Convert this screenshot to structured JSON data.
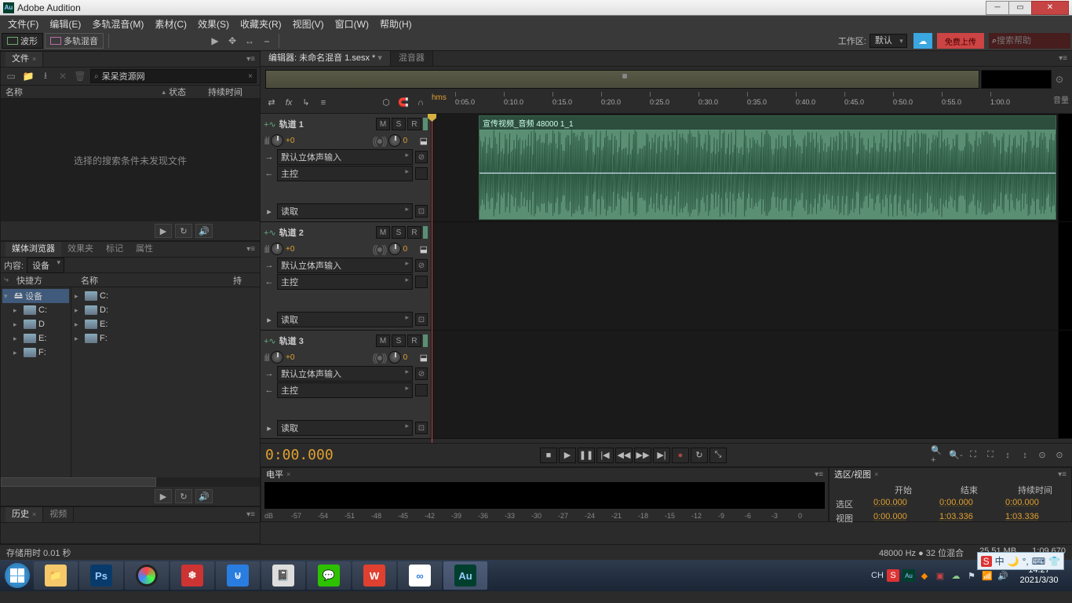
{
  "titlebar": {
    "app": "Au",
    "title": "Adobe Audition"
  },
  "menu": [
    "文件(F)",
    "编辑(E)",
    "多轨混音(M)",
    "素材(C)",
    "效果(S)",
    "收藏夹(R)",
    "视图(V)",
    "窗口(W)",
    "帮助(H)"
  ],
  "modes": {
    "waveform": "波形",
    "multitrack": "多轨混音"
  },
  "workspace": {
    "label": "工作区:",
    "value": "默认"
  },
  "search_help": {
    "placeholder": "搜索帮助"
  },
  "cloud": "☁",
  "red_upload": "免费上传",
  "panels": {
    "files": {
      "tab": "文件",
      "search_value": "呆呆资源网",
      "cols": {
        "name": "名称",
        "status": "状态",
        "duration": "持续时间"
      },
      "empty": "选择的搜索条件未发现文件"
    },
    "media": {
      "tabs": [
        "媒体浏览器",
        "效果夹",
        "标记",
        "属性"
      ],
      "content_label": "内容:",
      "content_value": "设备",
      "cols": {
        "shortcut": "快捷方",
        "name": "名称",
        "duration": "持"
      },
      "tree": [
        {
          "label": "设备",
          "sel": true
        },
        {
          "label": "C:"
        },
        {
          "label": "D"
        },
        {
          "label": "E:"
        },
        {
          "label": "F:"
        }
      ],
      "list": [
        "C:",
        "D:",
        "E:",
        "F:"
      ]
    },
    "history": {
      "tabs": [
        "历史",
        "视频"
      ]
    },
    "levels": {
      "tab": "电平",
      "scale": [
        "dB",
        "-57",
        "-54",
        "-51",
        "-48",
        "-45",
        "-42",
        "-39",
        "-36",
        "-33",
        "-30",
        "-27",
        "-24",
        "-21",
        "-18",
        "-15",
        "-12",
        "-9",
        "-6",
        "-3",
        "0"
      ]
    },
    "selection": {
      "tab": "选区/视图",
      "headers": [
        "开始",
        "结束",
        "持续时间"
      ],
      "rows": [
        {
          "label": "选区",
          "start": "0:00.000",
          "end": "0:00.000",
          "dur": "0:00.000"
        },
        {
          "label": "视图",
          "start": "0:00.000",
          "end": "1:03.336",
          "dur": "1:03.336"
        }
      ]
    }
  },
  "editor": {
    "tab_main": "编辑器: 未命名混音 1.sesx *",
    "tab_mixer": "混音器",
    "ruler_unit": "hms",
    "ruler": [
      "0:05.0",
      "0:10.0",
      "0:15.0",
      "0:20.0",
      "0:25.0",
      "0:30.0",
      "0:35.0",
      "0:40.0",
      "0:45.0",
      "0:50.0",
      "0:55.0",
      "1:00.0"
    ],
    "volume_label": "音量",
    "timecode": "0:00.000",
    "clip_name": "宣传视频_音频 48000 1_1"
  },
  "tracks": [
    {
      "name": "轨道 1",
      "vol": "+0",
      "pan": "0",
      "input": "默认立体声输入",
      "output": "主控",
      "read": "读取",
      "has_clip": true
    },
    {
      "name": "轨道 2",
      "vol": "+0",
      "pan": "0",
      "input": "默认立体声输入",
      "output": "主控",
      "read": "读取",
      "has_clip": false
    },
    {
      "name": "轨道 3",
      "vol": "+0",
      "pan": "0",
      "input": "默认立体声输入",
      "output": "主控",
      "read": "读取",
      "has_clip": false
    }
  ],
  "statusbar": {
    "left": "存储用时 0.01 秒",
    "sample": "48000 Hz ● 32 位混合",
    "mem": "25.51 MB",
    "dur": "1:09.670"
  },
  "taskbar": {
    "ime": "CH",
    "time": "14:27",
    "date": "2021/3/30"
  }
}
